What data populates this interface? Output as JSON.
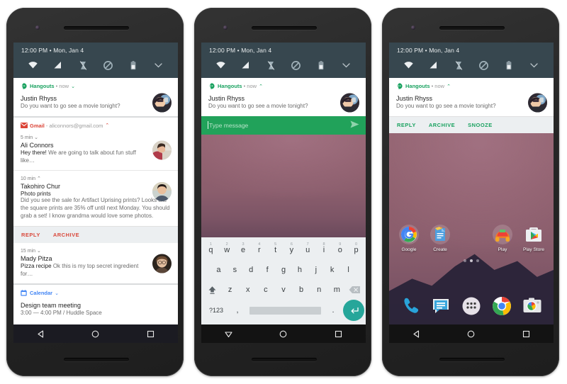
{
  "status_bar": {
    "time": "12:00 PM",
    "separator": "•",
    "date": "Mon, Jan 4",
    "icons": [
      "wifi-icon",
      "signal-icon",
      "vibrate-off-icon",
      "do-not-disturb-icon",
      "battery-icon",
      "chevron-down-icon"
    ]
  },
  "colors": {
    "status_bar_bg": "#37474f",
    "hangouts_green": "#1aa260",
    "gmail_red": "#db4437",
    "calendar_blue": "#4285f4",
    "reply_bar_green": "#21a25a",
    "action_red": "#d9483b",
    "enter_key_teal": "#26a69a"
  },
  "phone1": {
    "label": "notification-shade-grouped",
    "groups": [
      {
        "app": "Hangouts",
        "app_icon": "hangouts-icon",
        "subtitle": "• now",
        "chevron": "⌄",
        "notifications": [
          {
            "title": "Justin Rhyss",
            "body": "Do you want to go see a movie tonight?",
            "avatar": "avatar-justin"
          }
        ]
      },
      {
        "app": "Gmail",
        "app_icon": "gmail-icon",
        "subtitle": "- aliconnors@gmail.com",
        "chevron": "⌃",
        "notifications": [
          {
            "time": "5 min",
            "chevron": "⌄",
            "title": "Ali Connors",
            "body": "Hey there! We are going to talk about fun stuff like…",
            "body_lead": "Hey there!",
            "avatar": "avatar-ali"
          },
          {
            "time": "10 min",
            "chevron": "⌃",
            "title": "Takohiro Chur",
            "subtitle": "Photo prints",
            "body": "Did you see the sale for Artifact Uprising prints? Looks like the square prints are 35% off until next Monday. You should grab a set! I know grandma would love some photos.",
            "avatar": "avatar-takohiro",
            "actions": [
              "REPLY",
              "ARCHIVE"
            ]
          },
          {
            "time": "15 min",
            "chevron": "⌄",
            "title": "Mady Pitza",
            "body_lead": "Pizza recipe",
            "body": "Ok this is my top secret ingredient for…",
            "avatar": "avatar-mady"
          }
        ]
      },
      {
        "app": "Calendar",
        "app_icon": "calendar-icon",
        "subtitle": "",
        "chevron": "⌄",
        "notifications": [
          {
            "title": "Design team meeting",
            "body": "3:00 — 4:00 PM / Huddle Space"
          }
        ]
      }
    ]
  },
  "phone2": {
    "label": "notification-inline-reply",
    "group": {
      "app": "Hangouts",
      "app_icon": "hangouts-icon",
      "subtitle": "• now",
      "chevron": "⌃"
    },
    "notification": {
      "title": "Justin Rhyss",
      "body": "Do you want to go see a movie tonight?",
      "avatar": "avatar-justin"
    },
    "reply": {
      "placeholder": "Type message",
      "value": "",
      "send_icon": "send-icon"
    },
    "keyboard": {
      "row1_numbers": [
        "1",
        "2",
        "3",
        "4",
        "5",
        "6",
        "7",
        "8",
        "9",
        "0"
      ],
      "row1": [
        "q",
        "w",
        "e",
        "r",
        "t",
        "y",
        "u",
        "i",
        "o",
        "p"
      ],
      "row2": [
        "a",
        "s",
        "d",
        "f",
        "g",
        "h",
        "j",
        "k",
        "l"
      ],
      "row3": [
        "z",
        "x",
        "c",
        "v",
        "b",
        "n",
        "m"
      ],
      "shift_icon": "shift-icon",
      "delete_icon": "backspace-icon",
      "symbols_key": "?123",
      "comma_key": ",",
      "period_key": ".",
      "space_key": "",
      "enter_icon": "enter-icon"
    }
  },
  "phone3": {
    "label": "notification-with-actions-home",
    "group": {
      "app": "Hangouts",
      "app_icon": "hangouts-icon",
      "subtitle": "• now",
      "chevron": "⌃"
    },
    "notification": {
      "title": "Justin Rhyss",
      "body": "Do you want to go see a movie tonight?",
      "avatar": "avatar-justin"
    },
    "actions": [
      "REPLY",
      "ARCHIVE",
      "SNOOZE"
    ],
    "home": {
      "apps": [
        {
          "label": "Google",
          "icon": "google-icon"
        },
        {
          "label": "Create",
          "icon": "create-docs-icon"
        },
        {
          "label": "",
          "icon": ""
        },
        {
          "label": "Play",
          "icon": "play-music-icon"
        },
        {
          "label": "Play Store",
          "icon": "play-store-icon"
        }
      ],
      "page_dots": 3,
      "active_dot": 1,
      "dock": [
        {
          "label": "Phone",
          "icon": "phone-icon"
        },
        {
          "label": "Messenger",
          "icon": "messenger-icon"
        },
        {
          "label": "All apps",
          "icon": "app-drawer-icon"
        },
        {
          "label": "Chrome",
          "icon": "chrome-icon"
        },
        {
          "label": "Camera",
          "icon": "camera-icon"
        }
      ]
    }
  },
  "nav_bar": {
    "back": "back-icon",
    "home": "home-icon",
    "recents": "recents-icon"
  }
}
